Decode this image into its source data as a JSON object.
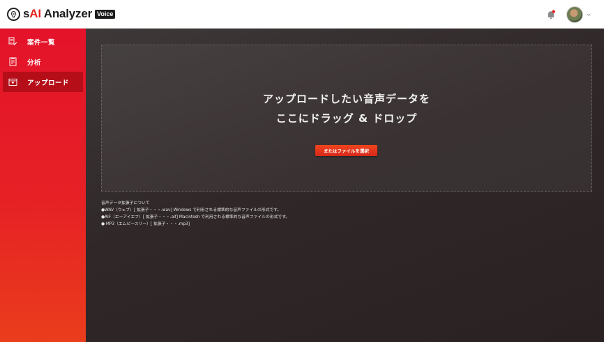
{
  "app": {
    "logo_prefix": "s",
    "logo_accent": "AI",
    "logo_suffix": " Analyzer",
    "logo_badge": "Voice"
  },
  "header": {
    "notification_icon": "bell-icon",
    "avatar_icon": "user-avatar",
    "chevron_icon": "chevron-down-icon"
  },
  "sidebar": {
    "items": [
      {
        "label": "案件一覧",
        "icon": "case-list-icon"
      },
      {
        "label": "分析",
        "icon": "analysis-icon"
      },
      {
        "label": "アップロード",
        "icon": "upload-icon",
        "active": true
      }
    ]
  },
  "upload": {
    "title_line1": "アップロードしたい音声データを",
    "title_line2": "ここにドラッグ & ドロップ",
    "select_button": "またはファイルを選択"
  },
  "info": {
    "heading": "音声データ拡張子について",
    "lines": [
      "●WAV（ウェブ）[ 拡張子・・・.wav] Windows で利用される標準的な音声ファイルの形式です。",
      "●AIF（エーアイエフ）[ 拡張子・・・.aif] Macintosh で利用される標準的な音声ファイルの形式です。",
      "● MP3（エムピースリー）[ 拡張子・・・.mp3]"
    ]
  },
  "colors": {
    "brand_red": "#e62125",
    "sidebar_active": "#b50e19",
    "button_orange": "#e8361c",
    "main_bg": "#2e2626"
  }
}
